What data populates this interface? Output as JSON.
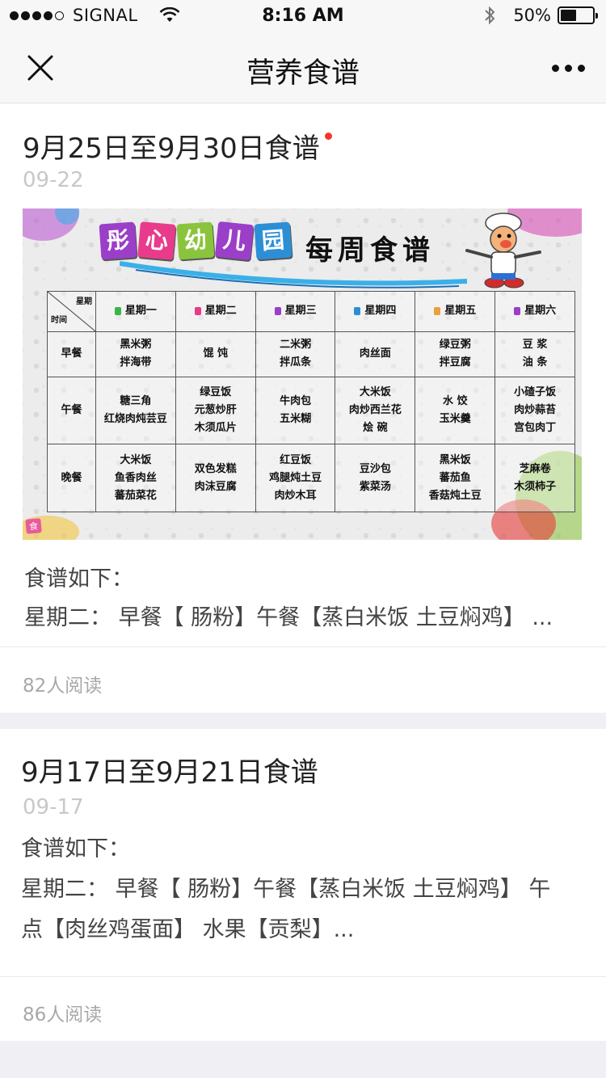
{
  "status_bar": {
    "carrier": "SIGNAL",
    "time": "8:16 AM",
    "battery": "50%",
    "battery_level": 0.5
  },
  "nav": {
    "title": "营养食谱"
  },
  "articles": [
    {
      "title": "9月25日至9月30日食谱",
      "date": "09-22",
      "text_lines": [
        "食谱如下：",
        "星期二：  早餐【 肠粉】午餐【蒸白米饭 土豆焖鸡】 ..."
      ],
      "reads": "82人阅读",
      "image": {
        "kindergarten_chars": [
          "彤",
          "心",
          "幼",
          "儿",
          "园"
        ],
        "kindergarten_colors": [
          "#9b3fc8",
          "#e83b8b",
          "#8ac43c",
          "#9b3fc8",
          "#2c8fd6"
        ],
        "heading": "每周食谱",
        "corner_top": "星期",
        "corner_bottom": "时间",
        "days": [
          "星期一",
          "星期二",
          "星期三",
          "星期四",
          "星期五",
          "星期六"
        ],
        "day_icon_colors": [
          "#3ab54a",
          "#e83b8b",
          "#9b3fc8",
          "#2c8fd6",
          "#e8a13b",
          "#9b3fc8"
        ],
        "meals": [
          {
            "name": "早餐",
            "cells": [
              [
                "黑米粥",
                "拌海带"
              ],
              [
                "馄 饨"
              ],
              [
                "二米粥",
                "拌瓜条"
              ],
              [
                "肉丝面"
              ],
              [
                "绿豆粥",
                "拌豆腐"
              ],
              [
                "豆 浆",
                "油 条"
              ]
            ]
          },
          {
            "name": "午餐",
            "cells": [
              [
                "糖三角",
                "红烧肉炖芸豆"
              ],
              [
                "绿豆饭",
                "元葱炒肝",
                "木须瓜片"
              ],
              [
                "牛肉包",
                "五米糊"
              ],
              [
                "大米饭",
                "肉炒西兰花",
                "烩 碗"
              ],
              [
                "水 饺",
                "玉米羹"
              ],
              [
                "小碴子饭",
                "肉炒蒜苔",
                "宫包肉丁"
              ]
            ]
          },
          {
            "name": "晚餐",
            "cells": [
              [
                "大米饭",
                "鱼香肉丝",
                "蕃茄菜花"
              ],
              [
                "双色发糕",
                "肉沫豆腐"
              ],
              [
                "红豆饭",
                "鸡腿炖土豆",
                "肉炒木耳"
              ],
              [
                "豆沙包",
                "紫菜汤"
              ],
              [
                "黑米饭",
                "蕃茄鱼",
                "香菇炖土豆"
              ],
              [
                "芝麻卷",
                "木须柿子"
              ]
            ]
          }
        ]
      }
    },
    {
      "title": "9月17日至9月21日食谱",
      "date": "09-17",
      "text_lines": [
        "食谱如下：",
        "星期二：  早餐【 肠粉】午餐【蒸白米饭 土豆焖鸡】 午",
        "点【肉丝鸡蛋面】 水果【贡梨】..."
      ],
      "reads": "86人阅读"
    }
  ]
}
